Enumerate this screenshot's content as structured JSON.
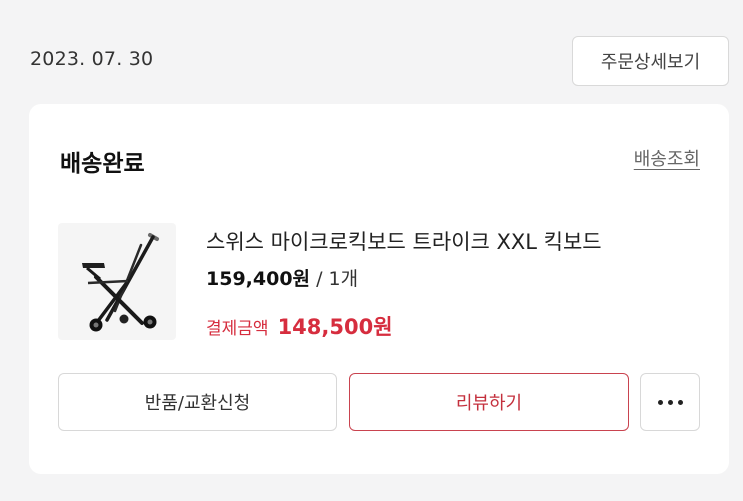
{
  "order": {
    "date": "2023. 07. 30",
    "detail_button": "주문상세보기"
  },
  "card": {
    "status": "배송완료",
    "track_link": "배송조회",
    "product": {
      "name": "스위스 마이크로킥보드 트라이크 XXL 킥보드",
      "price": "159,400원",
      "quantity": " / 1개",
      "payment_label": "결제금액",
      "payment_amount": "148,500원",
      "image_icon": "kickboard-tricycle-image"
    },
    "buttons": {
      "return_exchange": "반품/교환신청",
      "review": "리뷰하기",
      "more_icon": "more-dots-icon"
    }
  },
  "colors": {
    "accent": "#d62d3e",
    "background": "#f4f4f5",
    "card": "#ffffff"
  }
}
